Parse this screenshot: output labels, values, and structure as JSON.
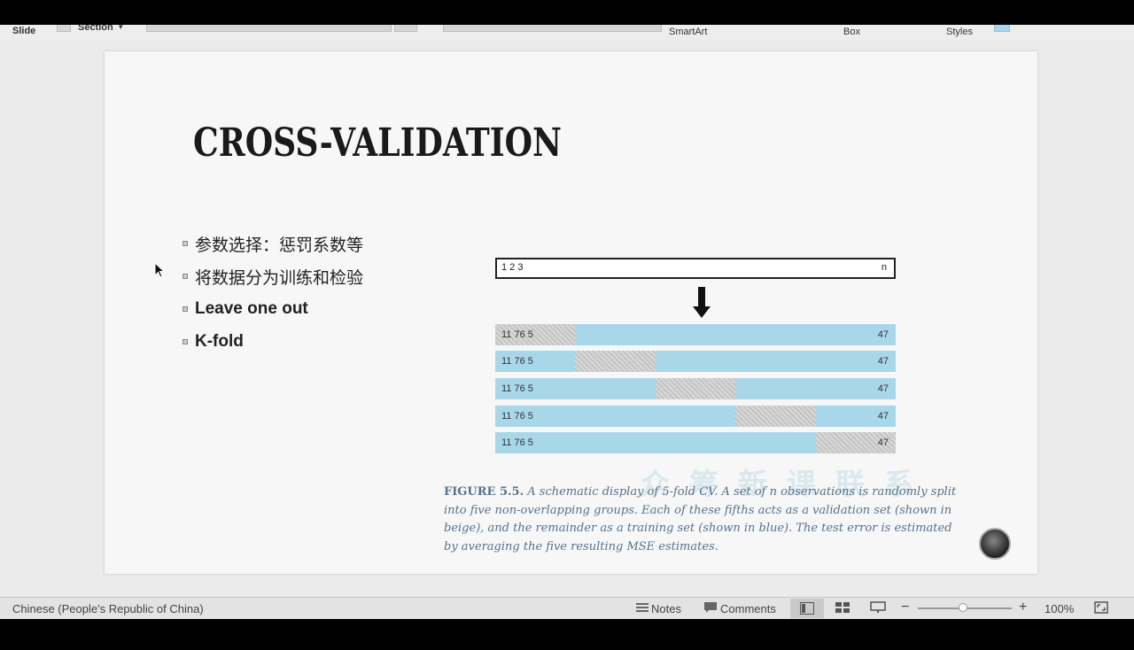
{
  "ribbon": {
    "slide_label": "Slide",
    "section_label": "Section",
    "smartart_label": "SmartArt",
    "box_label": "Box",
    "styles_label": "Styles"
  },
  "slide": {
    "title": "CROSS-VALIDATION",
    "bullets": [
      {
        "text": "参数选择：惩罚系数等",
        "bold": false
      },
      {
        "text": "将数据分为训练和检验",
        "bold": false
      },
      {
        "text": "Leave one out",
        "bold": true
      },
      {
        "text": "K-fold",
        "bold": true
      }
    ],
    "figure": {
      "top_box_left": "1 2 3",
      "top_box_right": "n",
      "rows": [
        {
          "label": "11 76 5",
          "right": "47",
          "validation_fold": 1
        },
        {
          "label": "11 76 5",
          "right": "47",
          "validation_fold": 2
        },
        {
          "label": "11 76 5",
          "right": "47",
          "validation_fold": 3
        },
        {
          "label": "11 76 5",
          "right": "47",
          "validation_fold": 4
        },
        {
          "label": "11 76 5",
          "right": "47",
          "validation_fold": 5
        }
      ],
      "caption_label": "FIGURE 5.5.",
      "caption_text": "A schematic display of 5-fold CV. A set of n observations is randomly split into five non-overlapping groups. Each of these fifths acts as a validation set (shown in beige), and the remainder as a training set (shown in blue). The test error is estimated by averaging the five resulting MSE estimates.",
      "colors": {
        "training": "#a9d7ea",
        "validation": "#d2d2d2"
      }
    },
    "watermark": "众筹新课联系"
  },
  "status": {
    "language": "Chinese (People's Republic of China)",
    "notes_label": "Notes",
    "comments_label": "Comments",
    "zoom": "100%"
  }
}
